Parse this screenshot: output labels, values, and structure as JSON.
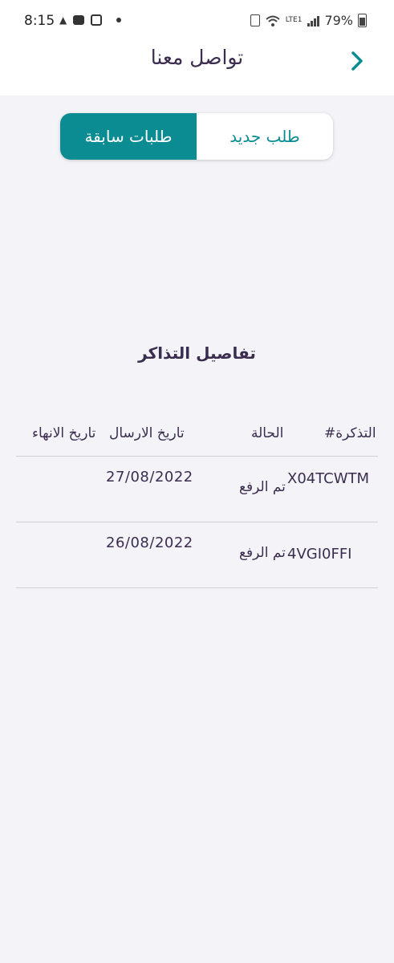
{
  "status_bar": {
    "time": "8:15",
    "battery": "79%",
    "network": "LTE1"
  },
  "header": {
    "title": "تواصل معنا",
    "back_icon": "chevron-right-icon"
  },
  "segments": {
    "new_request": "طلب جديد",
    "previous_requests": "طلبات سابقة"
  },
  "section": {
    "title": "تفاصيل التذاكر"
  },
  "table": {
    "headers": {
      "ticket": "#التذكرة",
      "status": "الحالة",
      "send_date": "تاريخ الارسال",
      "end_date": "تاريخ الانهاء"
    },
    "rows": [
      {
        "ticket": "X04TCWTM",
        "status": "تم الرفع",
        "send_date": "27/08/2022",
        "end_date": ""
      },
      {
        "ticket": "4VGI0FFI",
        "status": "تم الرفع",
        "send_date": "26/08/2022",
        "end_date": ""
      }
    ]
  },
  "colors": {
    "accent": "#0b8c93",
    "text": "#3a2d4f",
    "background": "#f4f4f8"
  }
}
